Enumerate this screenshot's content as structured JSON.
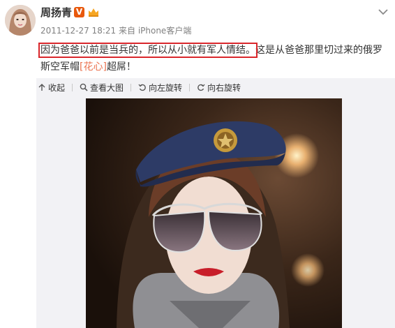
{
  "post": {
    "username": "周扬青",
    "verified_badge": "V",
    "timestamp": "2011-12-27 18:21",
    "via": "来自",
    "source": "iPhone客户端",
    "text": {
      "highlighted": "因为爸爸以前是当兵的，所以从小就有军人情结。",
      "rest_1": "这是从爸爸那里切过来的俄罗斯空军帽",
      "emoticon": "[花心]",
      "rest_2": "超屌！"
    }
  },
  "toolbar": {
    "collapse": "收起",
    "view_large": "查看大图",
    "rotate_left": "向左旋转",
    "rotate_right": "向右旋转"
  },
  "colors": {
    "highlight_box": "#d9262b",
    "link": "#eb7350",
    "verified": "#e8580c"
  },
  "icons": [
    "avatar",
    "verified-badge-icon",
    "member-icon",
    "chevron-down-icon",
    "collapse-icon",
    "magnifier-icon",
    "rotate-left-icon",
    "rotate-right-icon"
  ]
}
